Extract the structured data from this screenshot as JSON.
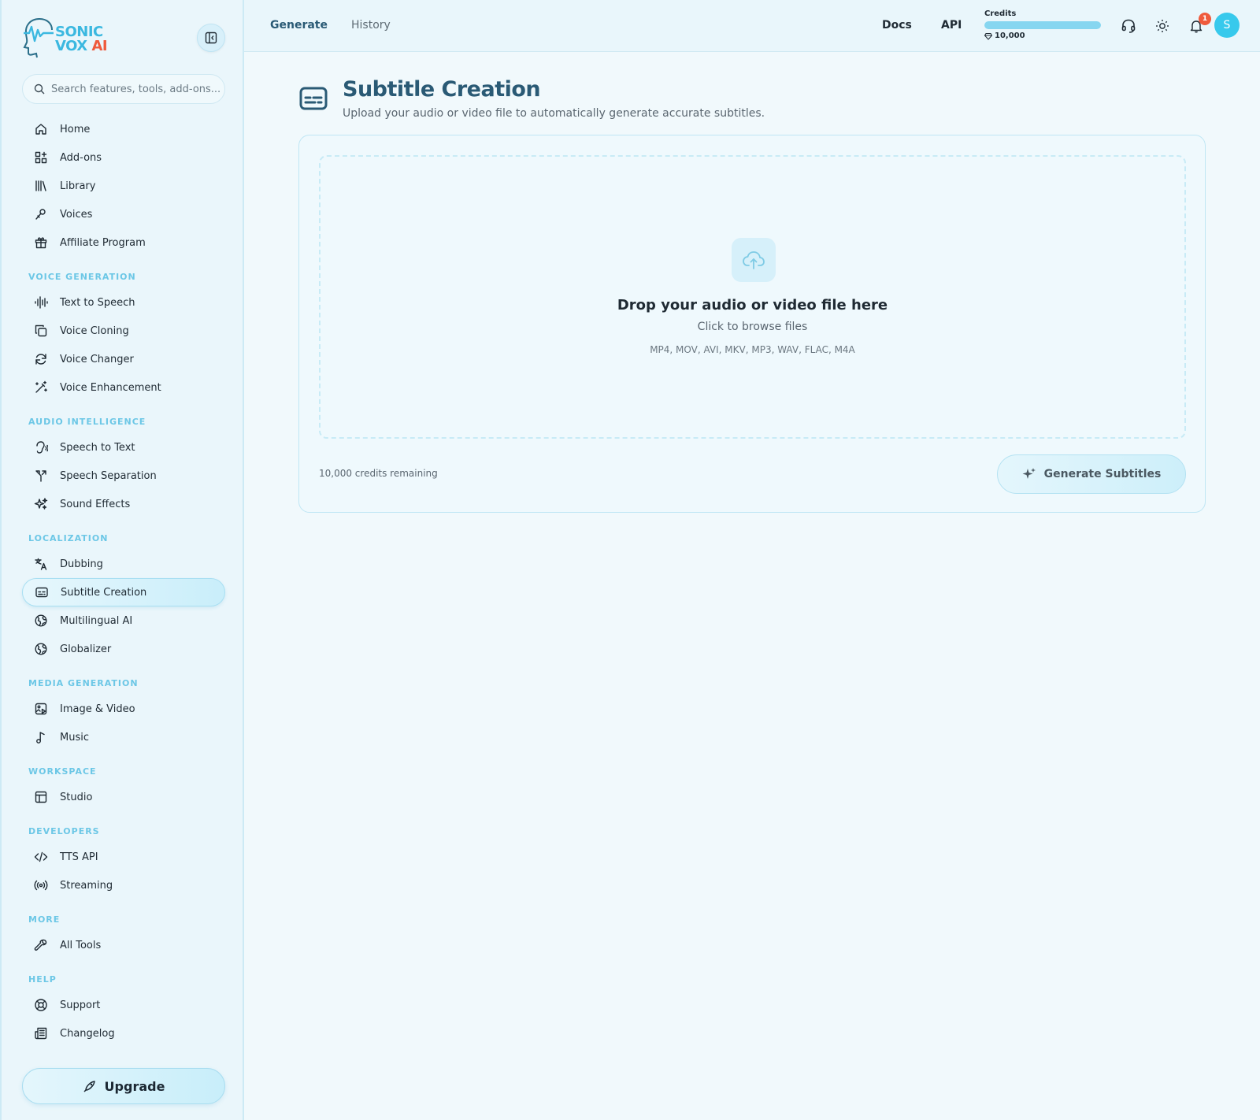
{
  "brand": {
    "line1": "SONIC",
    "line2": "VOX",
    "ai": "AI"
  },
  "search": {
    "placeholder": "Search features, tools, add-ons..."
  },
  "sidebar": {
    "top_items": [
      {
        "label": "Home",
        "icon": "home-icon"
      },
      {
        "label": "Add-ons",
        "icon": "grid-plus-icon"
      },
      {
        "label": "Library",
        "icon": "library-icon"
      },
      {
        "label": "Voices",
        "icon": "microphone-icon"
      },
      {
        "label": "Affiliate Program",
        "icon": "gift-icon"
      }
    ],
    "sections": [
      {
        "title": "VOICE GENERATION",
        "items": [
          {
            "label": "Text to Speech",
            "icon": "audio-lines-icon"
          },
          {
            "label": "Voice Cloning",
            "icon": "copy-icon"
          },
          {
            "label": "Voice Changer",
            "icon": "refresh-icon"
          },
          {
            "label": "Voice Enhancement",
            "icon": "magic-wand-icon"
          }
        ]
      },
      {
        "title": "AUDIO INTELLIGENCE",
        "items": [
          {
            "label": "Speech to Text",
            "icon": "ear-icon"
          },
          {
            "label": "Speech Separation",
            "icon": "split-icon"
          },
          {
            "label": "Sound Effects",
            "icon": "sparkles-icon"
          }
        ]
      },
      {
        "title": "LOCALIZATION",
        "items": [
          {
            "label": "Dubbing",
            "icon": "languages-icon"
          },
          {
            "label": "Subtitle Creation",
            "icon": "captions-icon",
            "active": true
          },
          {
            "label": "Multilingual AI",
            "icon": "globe-icon"
          },
          {
            "label": "Globalizer",
            "icon": "globe-icon"
          }
        ]
      },
      {
        "title": "MEDIA GENERATION",
        "items": [
          {
            "label": "Image & Video",
            "icon": "image-play-icon"
          },
          {
            "label": "Music",
            "icon": "music-note-icon"
          }
        ]
      },
      {
        "title": "WORKSPACE",
        "items": [
          {
            "label": "Studio",
            "icon": "layout-icon"
          }
        ]
      },
      {
        "title": "DEVELOPERS",
        "items": [
          {
            "label": "TTS API",
            "icon": "code-icon"
          },
          {
            "label": "Streaming",
            "icon": "radio-icon"
          }
        ]
      },
      {
        "title": "MORE",
        "items": [
          {
            "label": "All Tools",
            "icon": "wrench-icon"
          }
        ]
      },
      {
        "title": "HELP",
        "items": [
          {
            "label": "Support",
            "icon": "lifebuoy-icon"
          },
          {
            "label": "Changelog",
            "icon": "newspaper-icon"
          }
        ]
      }
    ],
    "upgrade_label": "Upgrade"
  },
  "topbar": {
    "tabs": [
      "Generate",
      "History"
    ],
    "docs": "Docs",
    "api": "API",
    "credits_label": "Credits",
    "credits_amount": "10,000",
    "credits_fill": 1.0,
    "notification_count": "1",
    "avatar_initial": "S"
  },
  "main": {
    "title": "Subtitle Creation",
    "subtitle": "Upload your audio or video file to automatically generate accurate subtitles.",
    "drop_title": "Drop your audio or video file here",
    "drop_sub": "Click to browse files",
    "formats": "MP4, MOV, AVI, MKV, MP3, WAV, FLAC, M4A",
    "credits_remaining": "10,000 credits remaining",
    "generate_label": "Generate Subtitles"
  },
  "colors": {
    "accent": "#3bb8e0",
    "title": "#2a5a75",
    "badge": "#ef5a3c",
    "avatar": "#37c9ec"
  }
}
